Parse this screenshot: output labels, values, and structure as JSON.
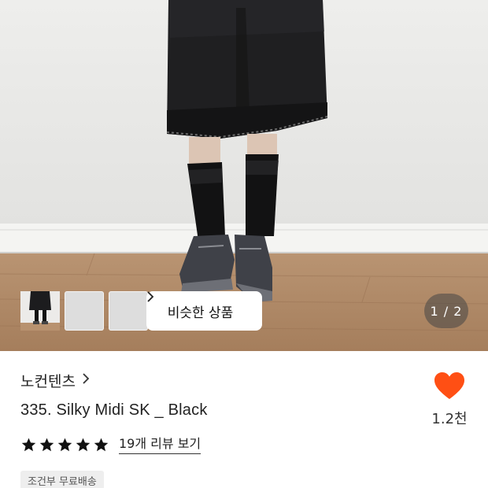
{
  "gallery": {
    "similar_label": "비슷한 상품",
    "page_indicator": "1 / 2",
    "thumbnails": [
      "thumbnail-1",
      "thumbnail-2",
      "thumbnail-3"
    ]
  },
  "product": {
    "brand": "노컨텐츠",
    "title": "335. Silky Midi SK _ Black",
    "rating": 5,
    "review_link": "19개 리뷰 보기",
    "shipping_badge": "조건부 무료배송"
  },
  "like": {
    "count": "1.2천",
    "color": "#ff4f14"
  },
  "icons": {
    "star": "star-icon",
    "heart": "heart-icon",
    "chevron": "chevron-right-icon"
  }
}
